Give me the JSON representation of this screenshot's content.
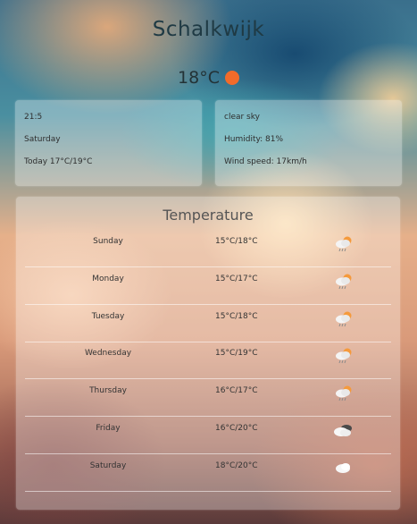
{
  "city": "Schalkwijk",
  "current": {
    "temperature": "18°C",
    "icon": "sun-icon",
    "accent": "#f26b2a"
  },
  "left_card": {
    "time": "21:5",
    "day": "Saturday",
    "today_range": "Today 17°C/19°C"
  },
  "right_card": {
    "condition": "clear sky",
    "humidity": "Humidity: 81%",
    "wind": "Wind speed: 17km/h"
  },
  "forecast": {
    "title": "Temperature",
    "rows": [
      {
        "day": "Sunday",
        "temp": "15°C/18°C",
        "icon": "sun-cloud-rain-icon"
      },
      {
        "day": "Monday",
        "temp": "15°C/17°C",
        "icon": "sun-cloud-rain-icon"
      },
      {
        "day": "Tuesday",
        "temp": "15°C/18°C",
        "icon": "sun-cloud-rain-icon"
      },
      {
        "day": "Wednesday",
        "temp": "15°C/19°C",
        "icon": "sun-cloud-rain-icon"
      },
      {
        "day": "Thursday",
        "temp": "16°C/17°C",
        "icon": "sun-cloud-rain-icon"
      },
      {
        "day": "Friday",
        "temp": "16°C/20°C",
        "icon": "broken-clouds-icon"
      },
      {
        "day": "Saturday",
        "temp": "18°C/20°C",
        "icon": "cloud-icon"
      }
    ]
  }
}
